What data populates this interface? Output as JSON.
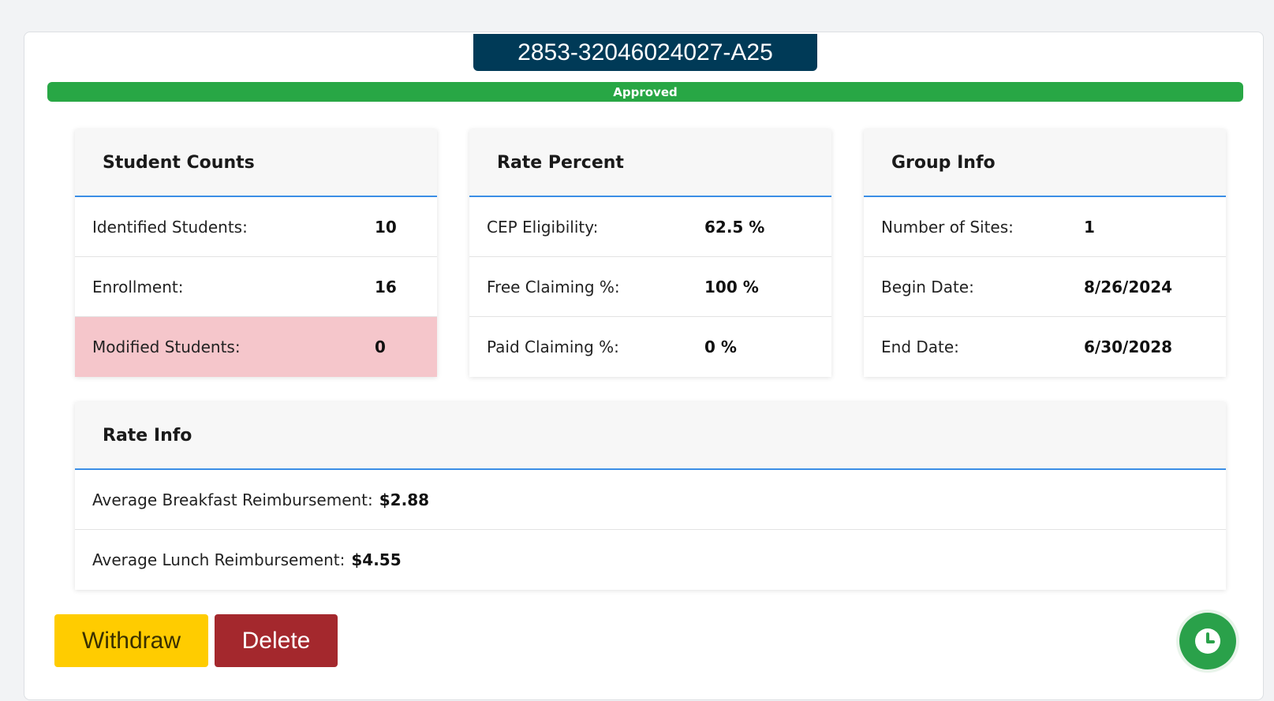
{
  "application": {
    "id": "2853-32046024027-A25",
    "status": "Approved",
    "status_color": "#28a745"
  },
  "student_counts": {
    "title": "Student Counts",
    "rows": [
      {
        "label": "Identified Students:",
        "value": "10"
      },
      {
        "label": "Enrollment:",
        "value": "16"
      },
      {
        "label": "Modified Students:",
        "value": "0"
      }
    ]
  },
  "rate_percent": {
    "title": "Rate Percent",
    "rows": [
      {
        "label": "CEP Eligibility:",
        "value": "62.5 %"
      },
      {
        "label": "Free Claiming %:",
        "value": "100 %"
      },
      {
        "label": "Paid Claiming %:",
        "value": "0 %"
      }
    ]
  },
  "group_info": {
    "title": "Group Info",
    "rows": [
      {
        "label": "Number of Sites:",
        "value": "1"
      },
      {
        "label": "Begin Date:",
        "value": "8/26/2024"
      },
      {
        "label": "End Date:",
        "value": "6/30/2028"
      }
    ]
  },
  "rate_info": {
    "title": "Rate Info",
    "rows": [
      {
        "label": "Average Breakfast Reimbursement:",
        "value": "$2.88"
      },
      {
        "label": "Average Lunch Reimbursement:",
        "value": "$4.55"
      }
    ]
  },
  "actions": {
    "withdraw_label": "Withdraw",
    "delete_label": "Delete",
    "history_icon": "clock-icon"
  },
  "colors": {
    "header_tab": "#003a57",
    "accent_line": "#3b8ee6",
    "withdraw": "#ffcc00",
    "delete": "#a4282d",
    "modified_highlight": "#f5c6cb"
  }
}
